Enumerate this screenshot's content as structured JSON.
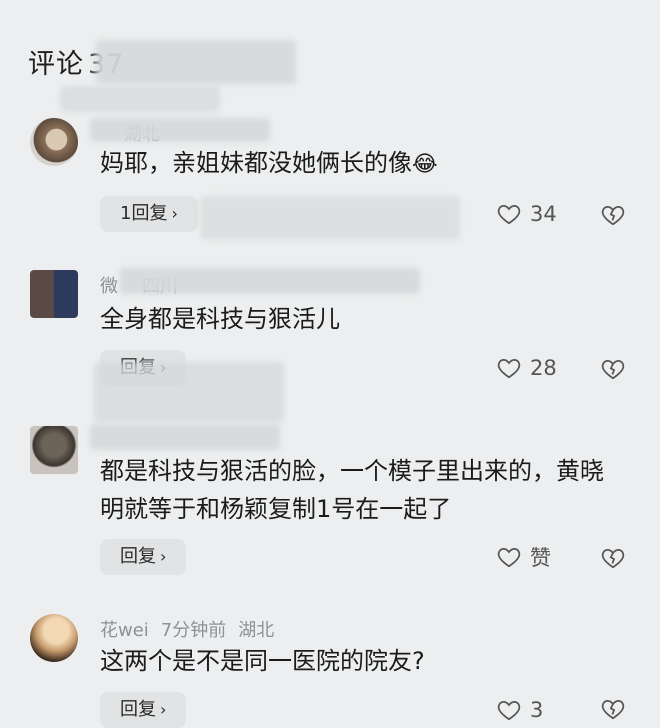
{
  "header": {
    "title": "评论",
    "count": "37"
  },
  "comments": [
    {
      "meta": {
        "user": "",
        "time": "",
        "location": "湖北"
      },
      "text": "妈耶，亲姐妹都没她俩长的像",
      "emoji": "😂",
      "reply_label": "1回复",
      "likes": "34"
    },
    {
      "meta": {
        "user": "微",
        "time": "",
        "location": "四川"
      },
      "text": "全身都是科技与狠活儿",
      "reply_label": "回复",
      "likes": "28"
    },
    {
      "meta": {
        "user": "",
        "time": "",
        "location": ""
      },
      "text": "都是科技与狠活的脸，一个模子里出来的，黄晓明就等于和杨颖复制1号在一起了",
      "reply_label": "回复",
      "likes": "赞"
    },
    {
      "meta": {
        "user": "花wei",
        "time": "7分钟前",
        "location": "湖北"
      },
      "text": "这两个是不是同一医院的院友?",
      "reply_label": "回复",
      "likes": "3"
    }
  ],
  "icons": {
    "reply_chevron": "chevron-right-icon",
    "like": "heart-outline-icon",
    "dislike": "broken-heart-icon"
  }
}
